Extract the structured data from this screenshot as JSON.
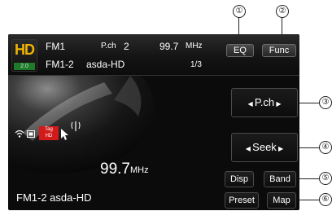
{
  "callouts": [
    "①",
    "②",
    "③",
    "④",
    "⑤",
    "⑥"
  ],
  "header": {
    "logo_text": "HD",
    "logo_sub": "2.0",
    "band": "FM1",
    "preset_label": "P.ch",
    "preset_number": "2",
    "frequency": "99.7",
    "frequency_unit": "MHz",
    "preset_name_line": "FM1-2",
    "station_name": "asda-HD",
    "page_indicator": "1/3"
  },
  "buttons": {
    "eq": "EQ",
    "func": "Func",
    "pch": "P.ch",
    "seek": "Seek",
    "disp": "Disp",
    "band": "Band",
    "preset": "Preset",
    "map": "Map"
  },
  "main": {
    "frequency": "99.7",
    "frequency_unit": "MHz",
    "station_line": "FM1-2  asda-HD"
  },
  "status": {
    "tag_top": "Tag",
    "tag_bottom": "HD"
  },
  "colors": {
    "screen_bg": "#0b0b0b",
    "hd_gold": "#f0b400",
    "tag_red": "#d21a1a",
    "text_white": "#ffffff"
  }
}
